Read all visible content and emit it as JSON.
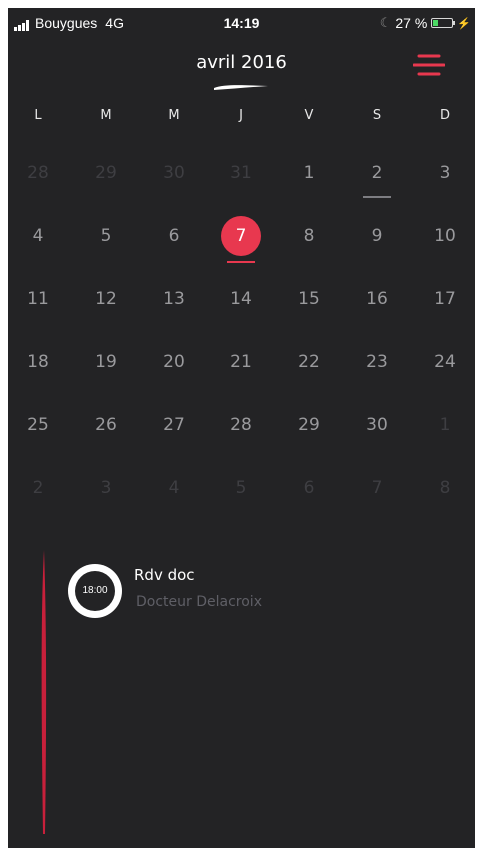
{
  "status_bar": {
    "carrier": "Bouygues",
    "network": "4G",
    "time": "14:19",
    "battery_percent": "27 %",
    "battery_level": 0.27,
    "icons": [
      "signal-icon",
      "moon-icon",
      "battery-icon",
      "charging-bolt-icon"
    ]
  },
  "header": {
    "month_title": "avril 2016",
    "menu_icon": "menu-icon",
    "accent_color": "#e8384f"
  },
  "weekdays": [
    "L",
    "M",
    "M",
    "J",
    "V",
    "S",
    "D"
  ],
  "calendar": {
    "weeks": [
      [
        {
          "day": "28",
          "state": "dim"
        },
        {
          "day": "29",
          "state": "dim"
        },
        {
          "day": "30",
          "state": "dim"
        },
        {
          "day": "31",
          "state": "dim"
        },
        {
          "day": "1",
          "state": "in-month"
        },
        {
          "day": "2",
          "state": "in-month",
          "underline": "grey"
        },
        {
          "day": "3",
          "state": "in-month"
        }
      ],
      [
        {
          "day": "4",
          "state": "in-month"
        },
        {
          "day": "5",
          "state": "in-month"
        },
        {
          "day": "6",
          "state": "in-month"
        },
        {
          "day": "7",
          "state": "today",
          "underline": "red"
        },
        {
          "day": "8",
          "state": "in-month"
        },
        {
          "day": "9",
          "state": "in-month"
        },
        {
          "day": "10",
          "state": "in-month"
        }
      ],
      [
        {
          "day": "11",
          "state": "in-month"
        },
        {
          "day": "12",
          "state": "in-month"
        },
        {
          "day": "13",
          "state": "in-month"
        },
        {
          "day": "14",
          "state": "in-month"
        },
        {
          "day": "15",
          "state": "in-month"
        },
        {
          "day": "16",
          "state": "in-month"
        },
        {
          "day": "17",
          "state": "in-month"
        }
      ],
      [
        {
          "day": "18",
          "state": "in-month"
        },
        {
          "day": "19",
          "state": "in-month"
        },
        {
          "day": "20",
          "state": "in-month"
        },
        {
          "day": "21",
          "state": "in-month"
        },
        {
          "day": "22",
          "state": "in-month"
        },
        {
          "day": "23",
          "state": "in-month"
        },
        {
          "day": "24",
          "state": "in-month"
        }
      ],
      [
        {
          "day": "25",
          "state": "in-month"
        },
        {
          "day": "26",
          "state": "in-month"
        },
        {
          "day": "27",
          "state": "in-month"
        },
        {
          "day": "28",
          "state": "in-month"
        },
        {
          "day": "29",
          "state": "in-month"
        },
        {
          "day": "30",
          "state": "in-month"
        },
        {
          "day": "1",
          "state": "dim"
        }
      ],
      [
        {
          "day": "2",
          "state": "dim"
        },
        {
          "day": "3",
          "state": "dim"
        },
        {
          "day": "4",
          "state": "dim"
        },
        {
          "day": "5",
          "state": "dim"
        },
        {
          "day": "6",
          "state": "dim"
        },
        {
          "day": "7",
          "state": "dim"
        },
        {
          "day": "8",
          "state": "dim"
        }
      ]
    ]
  },
  "event": {
    "time": "18:00",
    "title": "Rdv doc",
    "subtitle": "Docteur Delacroix",
    "icon": "clock-icon"
  },
  "colors": {
    "background": "#232325",
    "accent": "#e8384f",
    "day_text": "#9a9a9d",
    "dim_text": "#3e3e42",
    "subtitle_text": "#5f5f66"
  }
}
